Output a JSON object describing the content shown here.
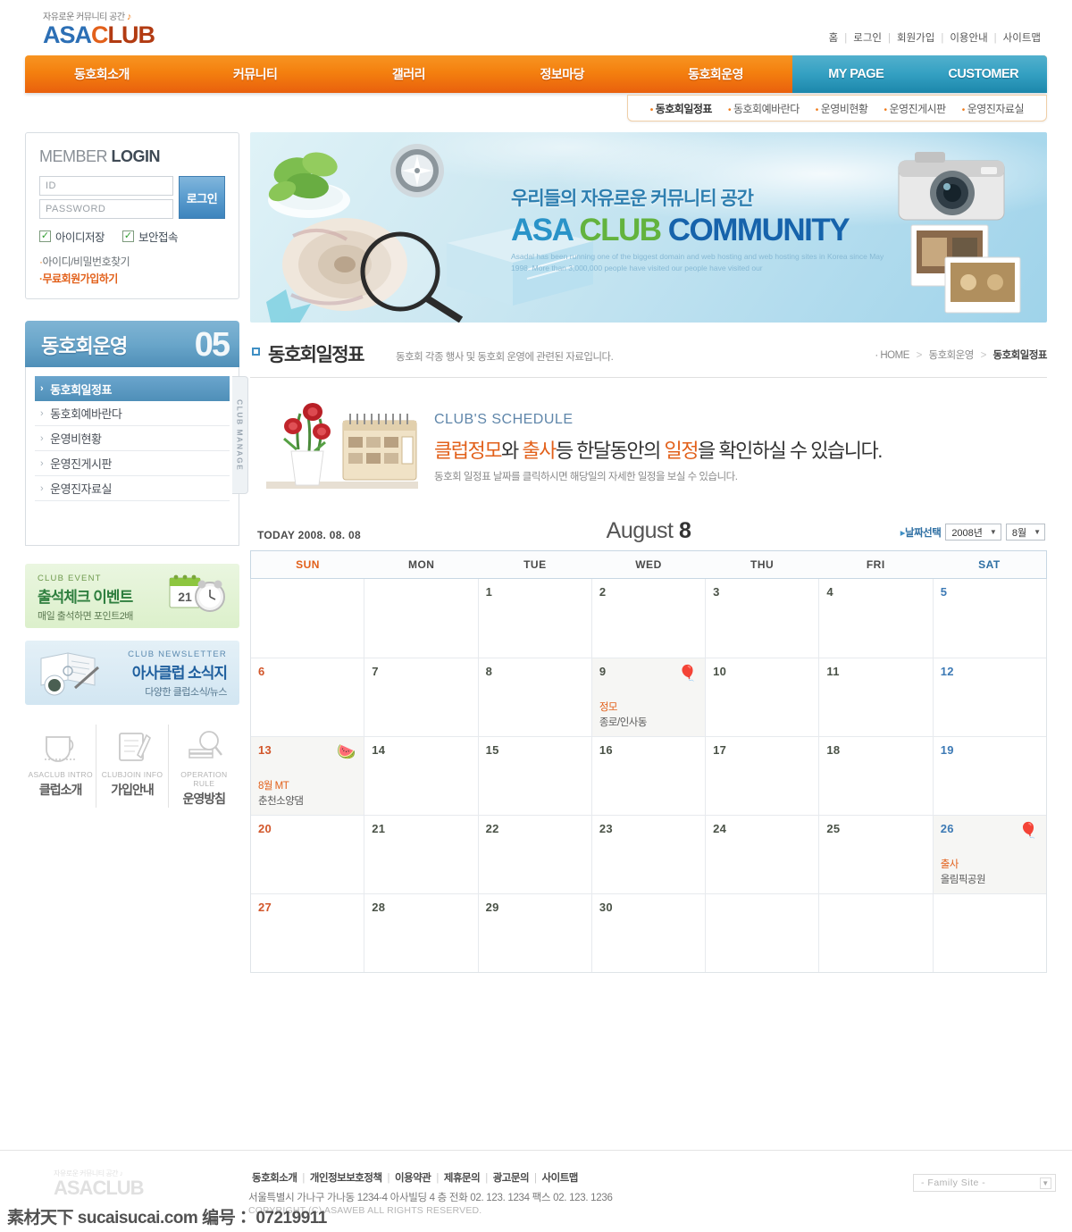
{
  "site": {
    "logo_tagline": "자유로운 커뮤니티 공간",
    "logo_note_icon": "music-note-icon",
    "logo_asa": "ASA",
    "logo_c": "C",
    "logo_lub": "LUB"
  },
  "toplinks": [
    {
      "label": "홈"
    },
    {
      "label": "로그인"
    },
    {
      "label": "회원가입"
    },
    {
      "label": "이용안내"
    },
    {
      "label": "사이트맵"
    }
  ],
  "gnb": {
    "items": [
      {
        "label": "동호회소개"
      },
      {
        "label": "커뮤니티"
      },
      {
        "label": "갤러리"
      },
      {
        "label": "정보마당"
      },
      {
        "label": "동호회운영"
      }
    ],
    "right_items": [
      {
        "label": "MY PAGE"
      },
      {
        "label": "CUSTOMER"
      }
    ],
    "accent_orange": "#f4800f",
    "accent_blue": "#34a0c2"
  },
  "subnav": [
    {
      "label": "동호회일정표",
      "active": true
    },
    {
      "label": "동호회예바란다",
      "active": false
    },
    {
      "label": "운영비현황",
      "active": false
    },
    {
      "label": "운영진게시판",
      "active": false
    },
    {
      "label": "운영진자료실",
      "active": false
    }
  ],
  "login": {
    "title_light": "MEMBER ",
    "title_bold": "LOGIN",
    "id_placeholder": "ID",
    "pw_placeholder": "PASSWORD",
    "button_label": "로그인",
    "checkboxes": [
      {
        "label": "아이디저장",
        "checked": true
      },
      {
        "label": "보안접속",
        "checked": true
      }
    ],
    "links": [
      {
        "label": "아이디/비밀번호찾기",
        "highlight": false
      },
      {
        "label": "무료회원가입하기",
        "highlight": true
      }
    ]
  },
  "sidemenu": {
    "title": "동호회운영",
    "number": "05",
    "tab_text": "CLUB MANAGE",
    "items": [
      {
        "label": "동호회일정표",
        "active": true
      },
      {
        "label": "동호회예바란다",
        "active": false
      },
      {
        "label": "운영비현황",
        "active": false
      },
      {
        "label": "운영진게시판",
        "active": false
      },
      {
        "label": "운영진자료실",
        "active": false
      }
    ]
  },
  "promos": [
    {
      "eyebrow": "CLUB EVENT",
      "head": "출석체크 이벤트",
      "sub": "매일 출석하면 포인트2배",
      "icon": "alarm-clock-calendar-icon"
    },
    {
      "eyebrow": "CLUB NEWSLETTER",
      "head": "아사클럽 소식지",
      "sub": "다양한 클럽소식/뉴스",
      "icon": "open-book-coffee-icon"
    }
  ],
  "quick": [
    {
      "en": "ASACLUB INTRO",
      "ko": "클럽소개",
      "icon": "coffee-cup-icon"
    },
    {
      "en": "CLUBJOIN INFO",
      "ko": "가입안내",
      "icon": "notepad-pen-icon"
    },
    {
      "en": "OPERATION RULE",
      "ko": "운영방침",
      "icon": "magnifier-books-icon"
    }
  ],
  "visual": {
    "handwriting": "우리들의 자유로운 커뮤니티 공간",
    "title_asa": "ASA ",
    "title_club": "CLUB ",
    "title_community": "COMMUNITY",
    "desc": "Asadal has been running one of the biggest domain and web hosting  and web hosting sites in Korea since May 1998. More than 3,000,000 people have visited our people have visited our"
  },
  "content": {
    "title": "동호회일정표",
    "desc": "동호회 각종 행사 및 동호회 운영에 관련된 자료입니다.",
    "breadcrumb": [
      {
        "label": "HOME",
        "current": false
      },
      {
        "label": "동호회운영",
        "current": false
      },
      {
        "label": "동호회일정표",
        "current": true
      }
    ]
  },
  "schedule_head": {
    "en": "CLUB'S SCHEDULE",
    "main_1": "클럽정모",
    "main_2": "와 ",
    "main_3": "출사",
    "main_4": "등 한달동안의 ",
    "main_5": "일정",
    "main_6": "을 확인하실 수 있습니다.",
    "sub": "동호회 일정표 날짜를 클릭하시면 해당일의 자세한 일정을 보실 수 있습니다.",
    "art_icon": "desk-calendar-roses-icon"
  },
  "calendar": {
    "today_label": "TODAY 2008. 08. 08",
    "month_en": "August",
    "month_num": "8",
    "select_label": "날짜선택",
    "year_value": "2008년",
    "month_value": "8월",
    "daynames": [
      "SUN",
      "MON",
      "TUE",
      "WED",
      "THU",
      "FRI",
      "SAT"
    ],
    "weeks": [
      [
        {
          "num": ""
        },
        {
          "num": ""
        },
        {
          "num": "1"
        },
        {
          "num": "2"
        },
        {
          "num": "3"
        },
        {
          "num": "4"
        },
        {
          "num": "5"
        }
      ],
      [
        {
          "num": "6"
        },
        {
          "num": "7"
        },
        {
          "num": "8"
        },
        {
          "num": "9",
          "event_title": "정모",
          "event_place": "종로/인사동",
          "icon": "hot-air-balloon-icon"
        },
        {
          "num": "10"
        },
        {
          "num": "11"
        },
        {
          "num": "12"
        }
      ],
      [
        {
          "num": "13",
          "event_title": "8월 MT",
          "event_place": "춘천소양댐",
          "icon": "watermelon-icon"
        },
        {
          "num": "14"
        },
        {
          "num": "15"
        },
        {
          "num": "16"
        },
        {
          "num": "17"
        },
        {
          "num": "18"
        },
        {
          "num": "19"
        }
      ],
      [
        {
          "num": "20"
        },
        {
          "num": "21"
        },
        {
          "num": "22"
        },
        {
          "num": "23"
        },
        {
          "num": "24"
        },
        {
          "num": "25"
        },
        {
          "num": "26",
          "event_title": "출사",
          "event_place": "올림픽공원",
          "icon": "hot-air-balloon-icon"
        }
      ],
      [
        {
          "num": "27"
        },
        {
          "num": "28"
        },
        {
          "num": "29"
        },
        {
          "num": "30"
        },
        {
          "num": ""
        },
        {
          "num": ""
        },
        {
          "num": ""
        }
      ]
    ]
  },
  "footer": {
    "logo_tagline": "자유로운 커뮤니티 공간",
    "logo_name": "ASACLUB",
    "links": [
      {
        "label": "동호회소개"
      },
      {
        "label": "개인정보보호정책"
      },
      {
        "label": "이용약관"
      },
      {
        "label": "제휴문의"
      },
      {
        "label": "광고문의"
      },
      {
        "label": "사이트맵"
      }
    ],
    "address": "서울특별시 가나구 가나동 1234-4 아사빌딩 4 층   전화 02. 123. 1234   팩스 02. 123. 1236",
    "copyright": "COPYRIGHT (C) ASAWEB ALL RIGHTS RESERVED.",
    "family_site": "- Family Site -"
  },
  "watermark": "素材天下 sucaisucai.com  编号： 07219911"
}
